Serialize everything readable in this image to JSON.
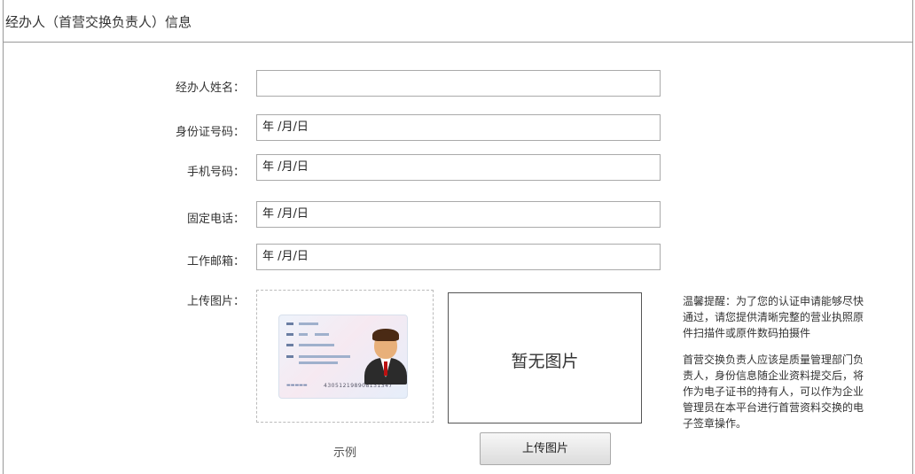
{
  "header": {
    "title": "经办人（首营交换负责人）信息"
  },
  "form": {
    "name_label": "经办人姓名：",
    "name_value": "",
    "id_label": "身份证号码：",
    "id_value": "年 /月/日",
    "phone_label": "手机号码：",
    "phone_value": "年 /月/日",
    "tel_label": "固定电话：",
    "tel_value": "年 /月/日",
    "email_label": "工作邮箱：",
    "email_value": "年 /月/日",
    "upload_label": "上传图片："
  },
  "sample": {
    "caption": "示例",
    "card_number": "430512198908131347"
  },
  "preview": {
    "placeholder": "暂无图片"
  },
  "upload_button": "上传图片",
  "tips": {
    "p1": "温馨提醒：为了您的认证申请能够尽快通过，请您提供清晰完整的营业执照原件扫描件或原件数码拍摄件",
    "p2": "首营交换负责人应该是质量管理部门负责人，身份信息随企业资料提交后，将作为电子证书的持有人，可以作为企业管理员在本平台进行首营资料交换的电子签章操作。"
  }
}
